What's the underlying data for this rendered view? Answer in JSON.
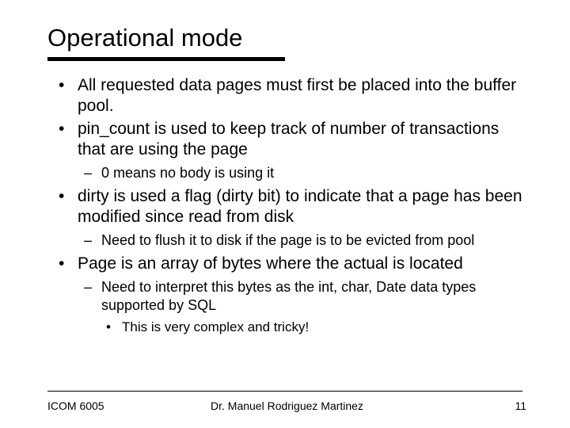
{
  "title": "Operational mode",
  "bullets": {
    "b1": "All requested data pages must first be placed into the buffer pool.",
    "b2": "pin_count is used to keep track of number of transactions that are using the page",
    "b2_1": "0 means no body is using it",
    "b3": "dirty is used a flag (dirty bit) to indicate that a page has been modified since read from disk",
    "b3_1": "Need to flush it to disk if the page is to be evicted from pool",
    "b4": "Page is an array of bytes where the actual is located",
    "b4_1": "Need to interpret this bytes as the int, char, Date data types supported by SQL",
    "b4_1_1": "This is very complex and tricky!"
  },
  "footer": {
    "left": "ICOM 6005",
    "center": "Dr. Manuel Rodriguez Martinez",
    "right": "11"
  }
}
